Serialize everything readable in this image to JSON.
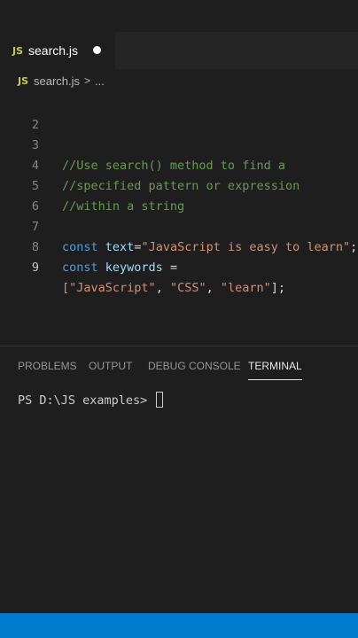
{
  "tab": {
    "badge": "JS",
    "filename": "search.js"
  },
  "breadcrumb": {
    "badge": "JS",
    "file": "search.js",
    "separator": ">",
    "more": "..."
  },
  "editor": {
    "lines": [
      {
        "number": "2",
        "code": ""
      },
      {
        "number": "3",
        "code": "//Use search() method to find a"
      },
      {
        "number": "4",
        "code": "//specified pattern or expression"
      },
      {
        "number": "5",
        "code": "//within a string"
      },
      {
        "number": "6",
        "code": ""
      },
      {
        "number": "7",
        "kw": "const",
        "var": "text",
        "eq": "=",
        "str": "\"JavaScript is easy to learn\"",
        "end": ";"
      },
      {
        "number": "8",
        "kw": "const",
        "var": "keywords",
        "eq": "="
      },
      {
        "number": "9",
        "open": "[",
        "s1": "\"JavaScript\"",
        "c1": ", ",
        "s2": "\"CSS\"",
        "c2": ", ",
        "s3": "\"learn\"",
        "close": "];"
      }
    ]
  },
  "panel": {
    "tabs": [
      "PROBLEMS",
      "OUTPUT",
      "DEBUG CONSOLE",
      "TERMINAL"
    ],
    "active_tab": "TERMINAL"
  },
  "terminal": {
    "prompt": "PS D:\\JS examples> "
  },
  "colors": {
    "status_bar": "#007acc",
    "editor_bg": "#1e1e1e",
    "js_badge": "#cbcb41"
  }
}
